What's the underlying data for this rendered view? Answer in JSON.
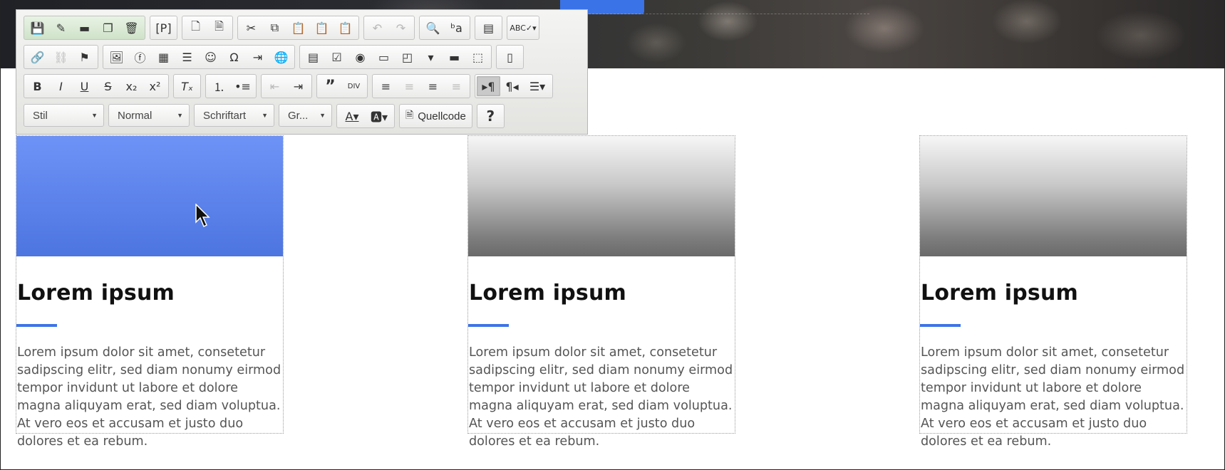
{
  "toolbar": {
    "style_combo": "Stil",
    "format_combo": "Normal",
    "font_combo": "Schriftart",
    "size_combo": "Gr...",
    "source_label": "Quellcode",
    "help_label": "?"
  },
  "cards": [
    {
      "title": "Lorem ipsum",
      "body": "Lorem ipsum dolor sit amet, consetetur sadipscing elitr, sed diam nonumy eirmod tempor invidunt ut labore et dolore magna aliquyam erat, sed diam voluptua. At vero eos et accusam et justo duo dolores et ea rebum."
    },
    {
      "title": "Lorem ipsum",
      "body": "Lorem ipsum dolor sit amet, consetetur sadipscing elitr, sed diam nonumy eirmod tempor invidunt ut labore et dolore magna aliquyam erat, sed diam voluptua. At vero eos et accusam et justo duo dolores et ea rebum."
    },
    {
      "title": "Lorem ipsum",
      "body": "Lorem ipsum dolor sit amet, consetetur sadipscing elitr, sed diam nonumy eirmod tempor invidunt ut labore et dolore magna aliquyam erat, sed diam voluptua. At vero eos et accusam et justo duo dolores et ea rebum."
    }
  ],
  "colors": {
    "accent": "#3e74e6",
    "card_blue": "#5b82ec",
    "toolbar_bg": "#e8e8e6"
  }
}
